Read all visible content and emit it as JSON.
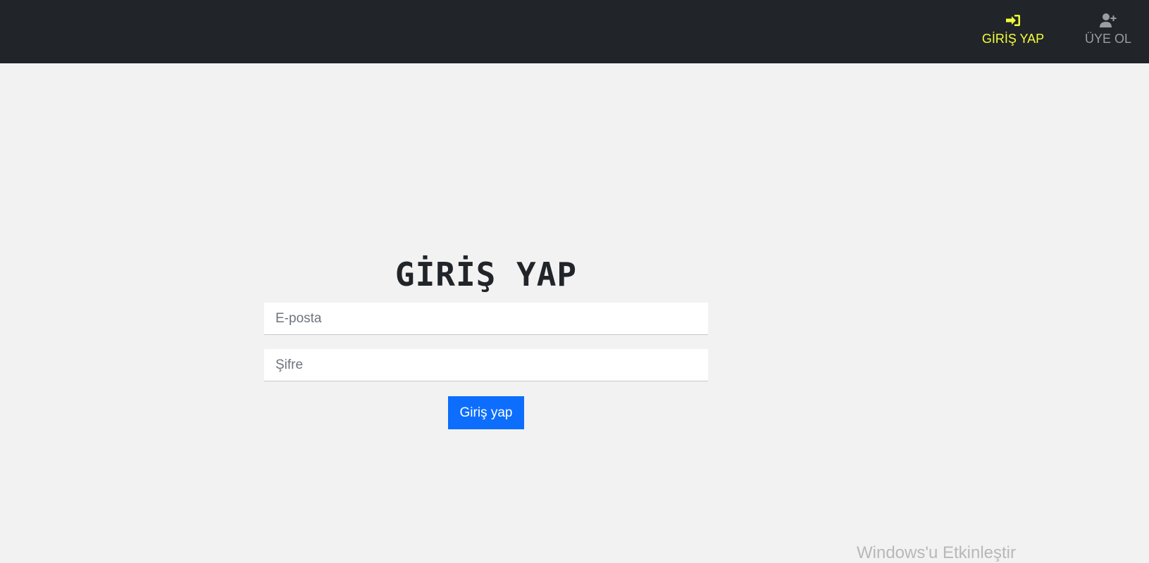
{
  "navbar": {
    "background": "#212529",
    "items": [
      {
        "label": "GİRİŞ YAP",
        "icon": "sign-in-icon",
        "color": "#f4ff3a",
        "active": true
      },
      {
        "label": "ÜYE OL",
        "icon": "user-plus-icon",
        "color": "#9a9da1",
        "active": false
      }
    ]
  },
  "login": {
    "title": "GİRİŞ YAP",
    "email_placeholder": "E-posta",
    "password_placeholder": "Şifre",
    "submit_label": "Giriş yap",
    "accent": "#0d6efd"
  },
  "watermark": {
    "text": "Windows'u Etkinleştir"
  }
}
